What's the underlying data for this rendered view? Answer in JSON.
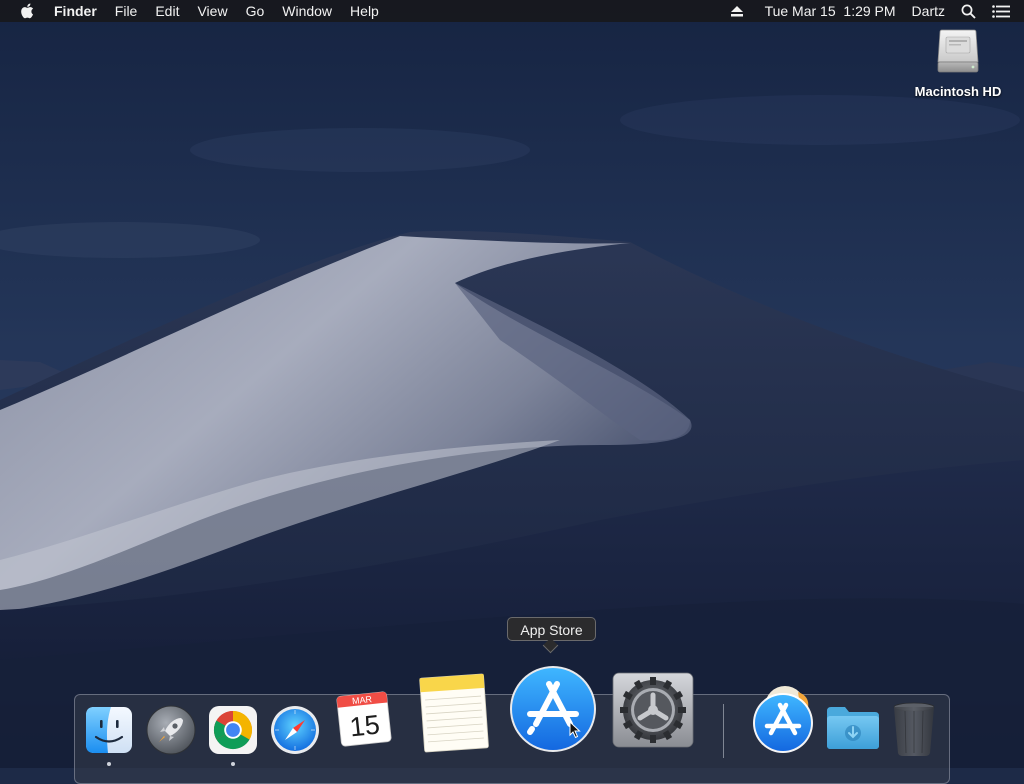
{
  "menubar": {
    "app_name": "Finder",
    "menus": [
      "File",
      "Edit",
      "View",
      "Go",
      "Window",
      "Help"
    ],
    "clock": "Tue Mar 15  1:29 PM",
    "user": "Dartz"
  },
  "desktop": {
    "drive_label": "Macintosh HD"
  },
  "tooltip": {
    "text": "App Store"
  },
  "dock": {
    "calendar": {
      "month": "MAR",
      "day": "15"
    },
    "items": [
      {
        "name": "Finder",
        "running": true
      },
      {
        "name": "Launchpad",
        "running": false
      },
      {
        "name": "Google Chrome",
        "running": true
      },
      {
        "name": "Safari",
        "running": false
      },
      {
        "name": "Calendar",
        "running": false
      },
      {
        "name": "Notes",
        "running": false
      },
      {
        "name": "App Store",
        "running": false,
        "hovered": true
      },
      {
        "name": "System Preferences",
        "running": false
      },
      {
        "name": "Downloads stack",
        "running": false
      },
      {
        "name": "Downloads folder",
        "running": false
      },
      {
        "name": "Trash",
        "running": false
      }
    ]
  },
  "colors": {
    "menubar_bg": "#18181c",
    "sky_top": "#1b2a4c",
    "sky_bottom": "#33476a",
    "dune_light": "#a9afc0",
    "dune_dark": "#1f2b4a",
    "app_store_blue": "#1a8cf0"
  }
}
